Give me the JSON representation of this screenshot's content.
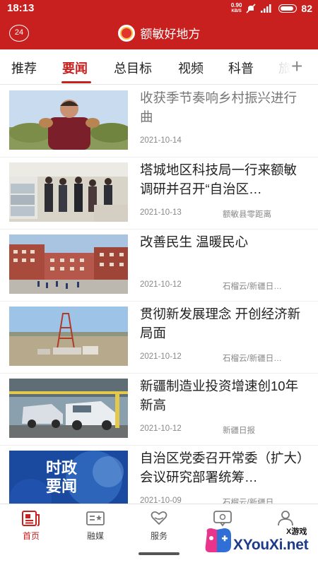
{
  "status_bar": {
    "time": "18:13",
    "net_speed": "0.90",
    "net_unit": "KB/S",
    "battery_level": "82"
  },
  "header": {
    "badge": "24",
    "title": "额敏好地方"
  },
  "tabs": [
    {
      "label": "推荐",
      "active": false
    },
    {
      "label": "要闻",
      "active": true
    },
    {
      "label": "总目标",
      "active": false
    },
    {
      "label": "视频",
      "active": false
    },
    {
      "label": "科普",
      "active": false
    },
    {
      "label": "旅",
      "active": false
    }
  ],
  "add_tab_label": "+",
  "news": [
    {
      "title": "收获季节奏响乡村振兴进行曲",
      "date": "2021-10-14",
      "source": "",
      "read": true
    },
    {
      "title": "塔城地区科技局一行来额敏调研并召开“自治区…",
      "date": "2021-10-13",
      "source": "额敏县零距离",
      "read": false
    },
    {
      "title": "改善民生 温暖民心",
      "date": "2021-10-12",
      "source": "石榴云/新疆日…",
      "read": false
    },
    {
      "title": "贯彻新发展理念 开创经济新局面",
      "date": "2021-10-12",
      "source": "石榴云/新疆日…",
      "read": false
    },
    {
      "title": "新疆制造业投资增速创10年新高",
      "date": "2021-10-12",
      "source": "新疆日报",
      "read": false
    },
    {
      "title": "自治区党委召开常委（扩大）会议研究部署统筹…",
      "date": "2021-10-09",
      "source": "石榴云/新疆日…",
      "read": false,
      "thumb_text": "时政要闻"
    }
  ],
  "thumb6": {
    "line1": "时政",
    "line2": "要闻"
  },
  "bottom_nav": [
    {
      "label": "首页",
      "icon": "news-icon",
      "active": true
    },
    {
      "label": "融媒",
      "icon": "media-icon",
      "active": false
    },
    {
      "label": "服务",
      "icon": "heart-hands-icon",
      "active": false
    },
    {
      "label": "",
      "icon": "chat-icon",
      "active": false
    },
    {
      "label": "",
      "icon": "user-icon",
      "active": false
    }
  ],
  "watermark": {
    "small": "X游戏",
    "text": "XYouXi.net"
  },
  "colors": {
    "brand": "#c8201e",
    "text": "#222222",
    "meta": "#888888"
  }
}
